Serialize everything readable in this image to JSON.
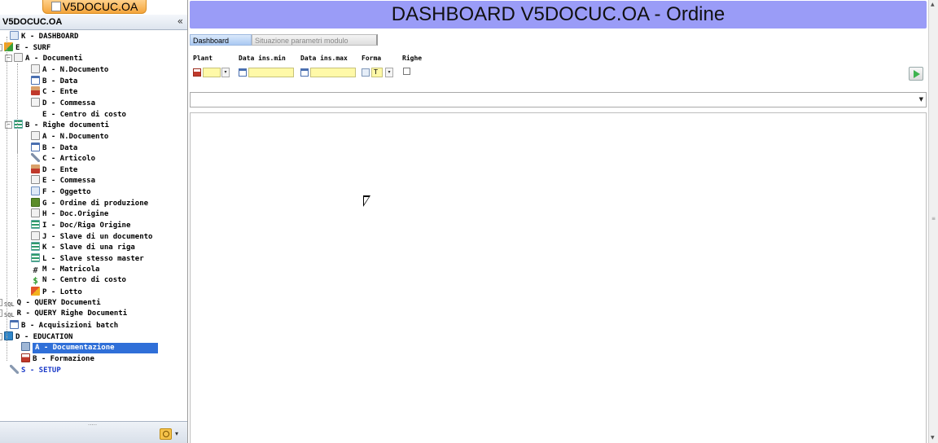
{
  "app": {
    "tab_label": "V5DOCUC.OA",
    "panel_title": "V5DOCUC.OA",
    "collapse_glyph": "«"
  },
  "tree": [
    {
      "label": "K - DASHBOARD",
      "icon": "dashboard-icon"
    },
    {
      "label": "E - SURF",
      "icon": "surf-icon",
      "toggle": "-"
    },
    {
      "label": "A - Documenti",
      "icon": "document-icon",
      "toggle": "-"
    },
    {
      "label": "A - N.Documento",
      "icon": "document-icon"
    },
    {
      "label": "B - Data",
      "icon": "calendar-icon"
    },
    {
      "label": "C - Ente",
      "icon": "person-icon"
    },
    {
      "label": "D - Commessa",
      "icon": "job-order-icon"
    },
    {
      "label": "E - Centro di costo",
      "icon": "dollar-icon"
    },
    {
      "label": "B - Righe documenti",
      "icon": "rows-icon",
      "toggle": "-"
    },
    {
      "label": "A - N.Documento",
      "icon": "document-icon"
    },
    {
      "label": "B - Data",
      "icon": "calendar-icon"
    },
    {
      "label": "C - Articolo",
      "icon": "wrench-icon"
    },
    {
      "label": "D - Ente",
      "icon": "person-icon"
    },
    {
      "label": "E - Commessa",
      "icon": "job-order-icon"
    },
    {
      "label": "F - Oggetto",
      "icon": "object-icon"
    },
    {
      "label": "G - Ordine di produzione",
      "icon": "production-order-icon"
    },
    {
      "label": "H - Doc.Origine",
      "icon": "document-icon"
    },
    {
      "label": "I - Doc/Riga Origine",
      "icon": "rows-icon"
    },
    {
      "label": "J - Slave di un documento",
      "icon": "document-icon"
    },
    {
      "label": "K - Slave di una riga",
      "icon": "rows-icon"
    },
    {
      "label": "L - Slave stesso master",
      "icon": "rows-icon"
    },
    {
      "label": "M - Matricola",
      "icon": "hash-icon",
      "glyph": "#"
    },
    {
      "label": "N - Centro di costo",
      "icon": "dollar-icon",
      "glyph": "$"
    },
    {
      "label": "P - Lotto",
      "icon": "lot-icon"
    },
    {
      "label": "Q - QUERY Documenti",
      "icon": "sql-icon",
      "toggle": "+",
      "glyph": "SQL"
    },
    {
      "label": "R - QUERY Righe Documenti",
      "icon": "sql-icon",
      "toggle": "+",
      "glyph": "SQL"
    },
    {
      "label": "B - Acquisizioni batch",
      "icon": "batch-icon"
    },
    {
      "label": "D - EDUCATION",
      "icon": "info-icon",
      "toggle": "-"
    },
    {
      "label": "A - Documentazione",
      "icon": "manual-icon",
      "selected": true
    },
    {
      "label": "B - Formazione",
      "icon": "training-icon"
    },
    {
      "label": "S - SETUP",
      "icon": "setup-icon"
    }
  ],
  "main": {
    "title": "DASHBOARD V5DOCUC.OA - Ordine",
    "tabs": [
      "Dashboard",
      "Situazione parametri modulo"
    ],
    "filters": {
      "plant_label": "Plant",
      "date_min_label": "Data ins.min",
      "date_max_label": "Data ins.max",
      "forma_label": "Forma",
      "righe_label": "Righe",
      "forma_value": "T",
      "plant_value": "",
      "date_min_value": "",
      "date_max_value": ""
    },
    "combo_value": ""
  },
  "colors": {
    "title_bar": "#9a9cf7",
    "selection": "#2f6fd8",
    "setup_text": "#1a3ac8",
    "field_yellow": "#fff9a8",
    "app_tab": "#f4a53c"
  }
}
